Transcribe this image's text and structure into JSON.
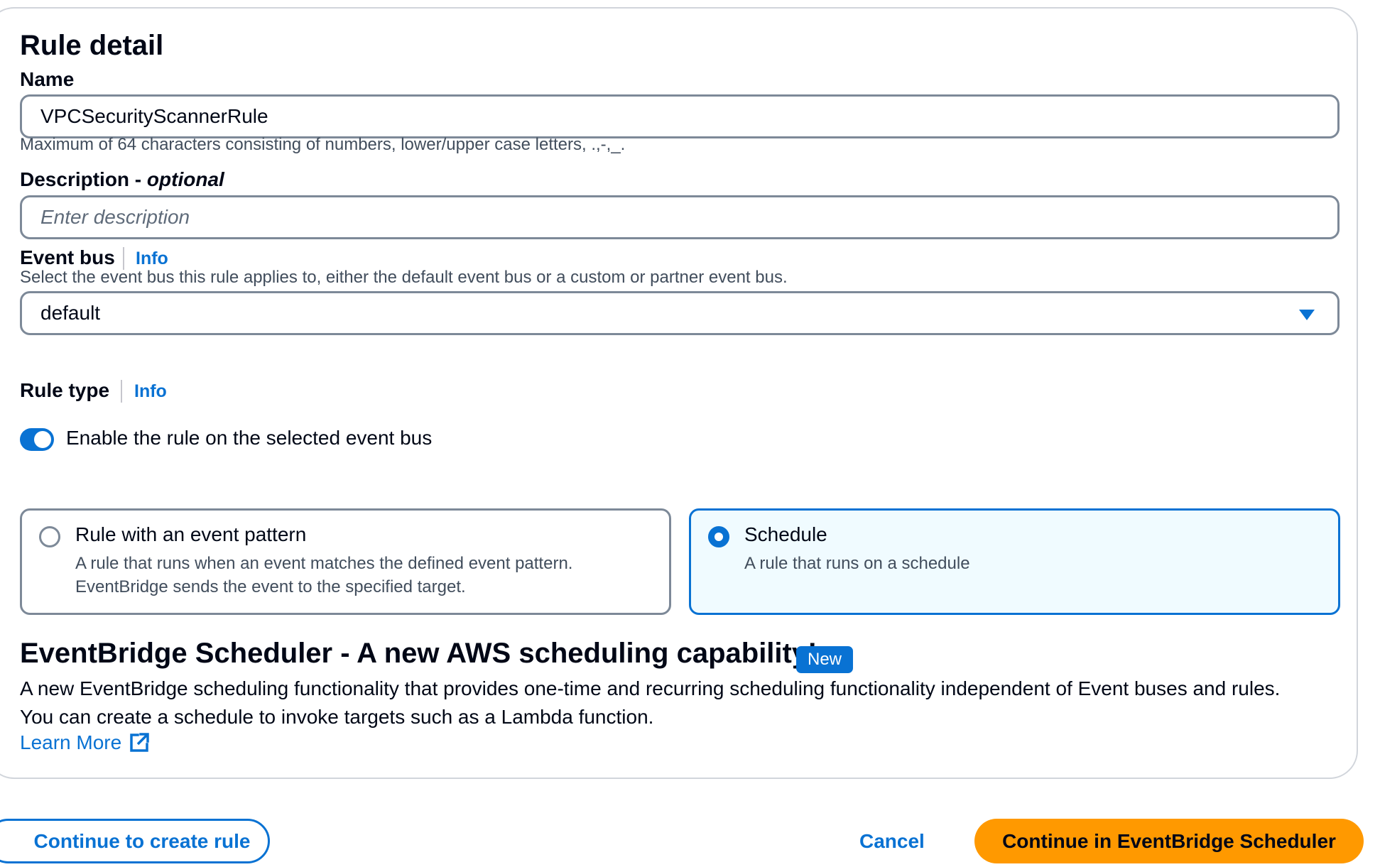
{
  "section": {
    "title": "Rule detail"
  },
  "name_field": {
    "label": "Name",
    "value": "VPCSecurityScannerRule",
    "constraint": "Maximum of 64 characters consisting of numbers, lower/upper case letters, .,-,_."
  },
  "description_field": {
    "label": "Description - ",
    "label_suffix": "optional",
    "placeholder": "Enter description"
  },
  "event_bus": {
    "label": "Event bus",
    "info": "Info",
    "hint": "Select the event bus this rule applies to, either the default event bus or a custom or partner event bus.",
    "selected": "default",
    "icon": "caret-down-icon"
  },
  "toggle": {
    "label": "Enable the rule on the selected event bus",
    "checked": true,
    "color": "#0972d3"
  },
  "rule_type": {
    "label": "Rule type",
    "info": "Info",
    "options": [
      {
        "title": "Rule with an event pattern",
        "desc_line1": "A rule that runs when an event matches the defined event pattern.",
        "desc_line2": "EventBridge sends the event to the specified target.",
        "selected": false
      },
      {
        "title": "Schedule",
        "desc_line1": "A rule that runs on a schedule",
        "selected": true
      }
    ]
  },
  "scheduler_promo": {
    "heading": "EventBridge Scheduler - A new AWS scheduling capability!",
    "badge": "New",
    "line1": "A new EventBridge scheduling functionality that provides one-time and recurring scheduling functionality independent of Event buses and rules.",
    "line2": "You can create a schedule to invoke targets such as a Lambda function.",
    "link": "Learn More",
    "link_icon": "external-link-icon"
  },
  "actions": {
    "continue_create": "Continue to create rule",
    "cancel": "Cancel",
    "continue_scheduler": "Continue in EventBridge Scheduler"
  },
  "colors": {
    "accent": "#0972d3",
    "primary_button": "#ff9900",
    "selected_tile_bg": "#f0fbff"
  }
}
